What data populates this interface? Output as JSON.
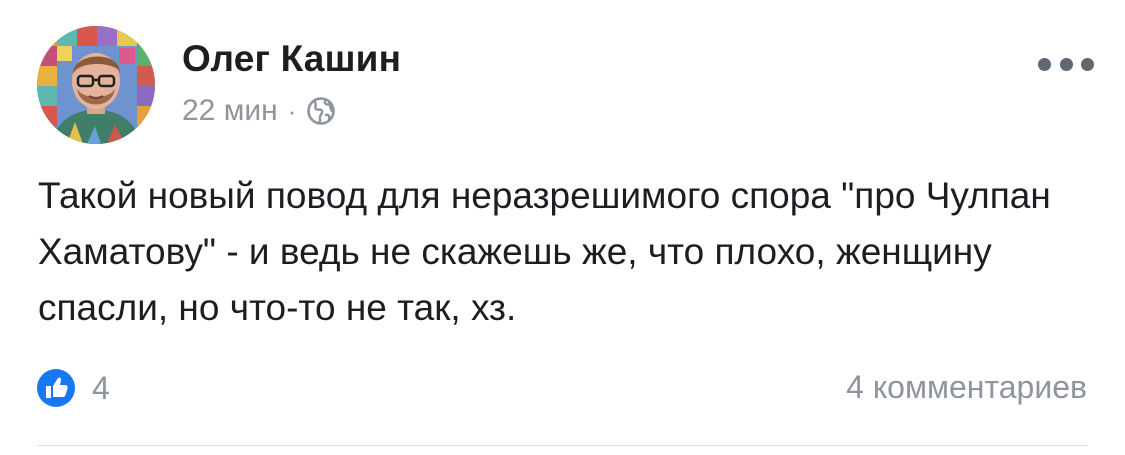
{
  "post": {
    "author": {
      "name": "Олег Кашин",
      "avatar_icon": "profile-photo"
    },
    "meta": {
      "time": "22 мин",
      "separator": "·",
      "privacy_icon": "globe-icon"
    },
    "menu_icon": "more-options-icon",
    "text": "Такой новый повод для неразрешимого спора \"про Чулпан Хаматову\" - и ведь не скажешь же, что плохо, женщину спасли, но что-то не так, хз.",
    "reactions": {
      "icon": "like-icon",
      "count": "4",
      "color": "#1877f2"
    },
    "comments": {
      "label": "4 комментариев"
    }
  }
}
